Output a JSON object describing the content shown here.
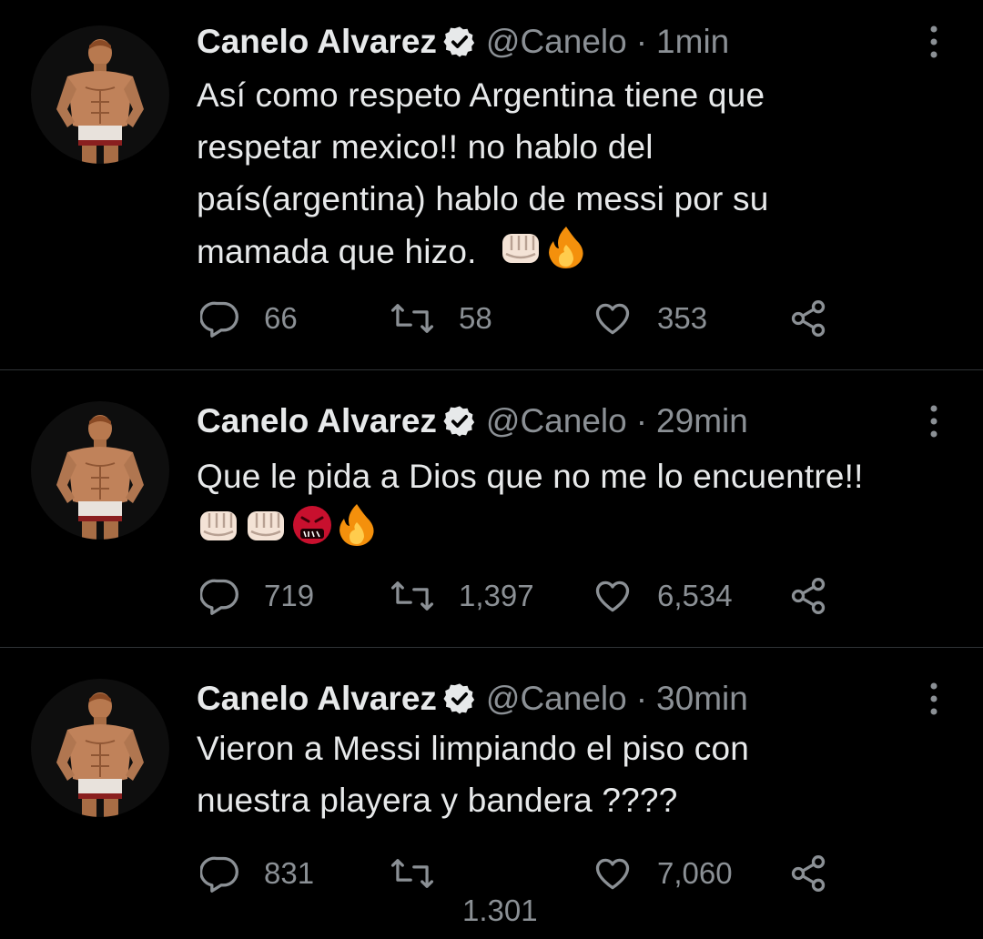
{
  "colors": {
    "background": "#000000",
    "text": "#e7e9ea",
    "secondary": "#8b9095",
    "divider": "#2f3336",
    "verified_badge": "#e7e9ea"
  },
  "tweets": [
    {
      "name": "Canelo Alvarez",
      "handle": "@Canelo",
      "separator": "·",
      "time": "1min",
      "text_lines": [
        "Así como respeto Argentina tiene que",
        "respetar mexico!! no hablo del",
        "país(argentina) hablo de messi por su",
        "mamada que hizo."
      ],
      "emojis": [
        "oncoming-fist",
        "fire"
      ],
      "replies": "66",
      "retweets": "58",
      "likes": "353",
      "icons": {
        "verified": "verified-badge-icon",
        "more": "more-vertical-icon",
        "reply": "reply-icon",
        "retweet": "retweet-icon",
        "like": "heart-icon",
        "share": "share-icon"
      }
    },
    {
      "name": "Canelo Alvarez",
      "handle": "@Canelo",
      "separator": "·",
      "time": "29min",
      "text_lines": [
        "Que le pida a Dios que no me lo encuentre!!"
      ],
      "emojis": [
        "oncoming-fist",
        "oncoming-fist",
        "face-with-symbols-on-mouth",
        "fire"
      ],
      "replies": "719",
      "retweets": "1,397",
      "likes": "6,534"
    },
    {
      "name": "Canelo Alvarez",
      "handle": "@Canelo",
      "separator": "·",
      "time": "30min",
      "text_lines": [
        "Vieron a Messi limpiando el piso con",
        "nuestra playera y bandera ????"
      ],
      "emojis": [],
      "replies": "831",
      "retweets": "1.301",
      "likes": "7,060"
    }
  ]
}
